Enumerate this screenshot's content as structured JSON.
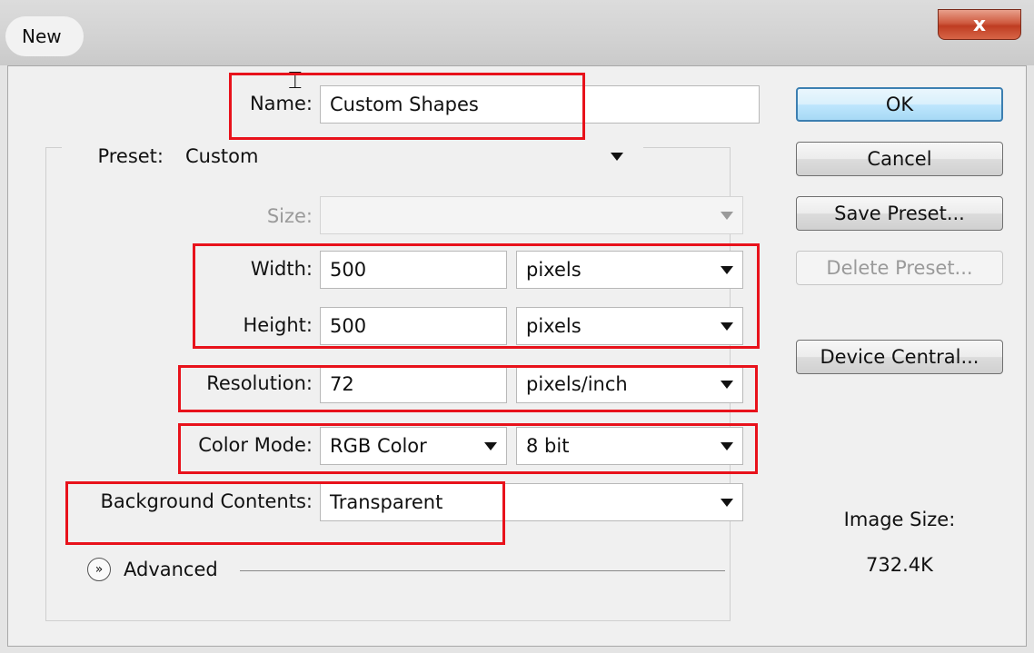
{
  "window": {
    "title": "New",
    "close_glyph": "x"
  },
  "form": {
    "name_label": "Name:",
    "name_value": "Custom Shapes",
    "preset_label": "Preset:",
    "preset_value": "Custom",
    "size_label": "Size:",
    "size_value": "",
    "width_label": "Width:",
    "width_value": "500",
    "width_unit": "pixels",
    "height_label": "Height:",
    "height_value": "500",
    "height_unit": "pixels",
    "resolution_label": "Resolution:",
    "resolution_value": "72",
    "resolution_unit": "pixels/inch",
    "color_mode_label": "Color Mode:",
    "color_mode_value": "RGB Color",
    "bit_depth_value": "8 bit",
    "background_label": "Background Contents:",
    "background_value": "Transparent",
    "advanced_label": "Advanced"
  },
  "buttons": {
    "ok": "OK",
    "cancel": "Cancel",
    "save_preset": "Save Preset...",
    "delete_preset": "Delete Preset...",
    "device_central": "Device Central..."
  },
  "info": {
    "image_size_label": "Image Size:",
    "image_size_value": "732.4K"
  },
  "colors": {
    "highlight": "#e8121b",
    "default_button": "#3c7fb1"
  },
  "icons": [
    "close-icon",
    "dropdown-arrow-icon",
    "chevron-down-icon",
    "text-cursor-icon"
  ]
}
